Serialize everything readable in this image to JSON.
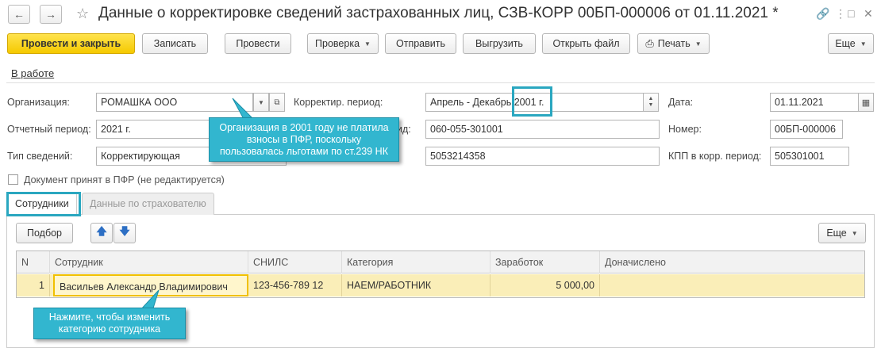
{
  "window": {
    "title": "Данные о корректировке сведений застрахованных лиц, СЗВ-КОРР 00БП-000006 от 01.11.2021 *"
  },
  "toolbar": {
    "post_close": "Провести и закрыть",
    "write": "Записать",
    "post": "Провести",
    "check": "Проверка",
    "send": "Отправить",
    "unload": "Выгрузить",
    "open_file": "Открыть файл",
    "print": "Печать",
    "more": "Еще"
  },
  "status_link": "В работе",
  "form": {
    "org_label": "Организация:",
    "org_value": "РОМАШКА ООО",
    "corr_period_label": "Корректир. период:",
    "corr_period_value": "Апрель - Декабрь 2001 г.",
    "date_label": "Дата:",
    "date_value": "01.11.2021",
    "report_period_label": "Отчетный период:",
    "report_period_value": "2021 г.",
    "reg_suffix_label": "ид:",
    "reg_value": "060-055-301001",
    "number_label": "Номер:",
    "number_value": "00БП-000006",
    "info_type_label": "Тип сведений:",
    "info_type_value": "Корректирующая",
    "inn_value": "5053214358",
    "kpp_label": "КПП в корр. период:",
    "kpp_value": "505301001",
    "accepted_label": "Документ принят в ПФР (не редактируется)"
  },
  "tabs": [
    {
      "label": "Сотрудники"
    },
    {
      "label": "Данные по страхователю"
    }
  ],
  "table_toolbar": {
    "select": "Подбор",
    "more": "Еще"
  },
  "table": {
    "columns": [
      "N",
      "Сотрудник",
      "СНИЛС",
      "Категория",
      "Заработок",
      "Доначислено"
    ],
    "rows": [
      {
        "n": "1",
        "employee": "Васильев Александр Владимирович",
        "snils": "123-456-789 12",
        "category": "НАЕМ/РАБОТНИК",
        "earnings": "5 000,00",
        "extra": ""
      }
    ]
  },
  "callouts": {
    "org": "Организация в 2001 году не платила взносы в ПФР, поскольку пользовалась льготами по ст.239 НК",
    "employee": "Нажмите, чтобы изменить категорию сотрудника"
  },
  "icons": {
    "back": "arrow-left-icon",
    "forward": "arrow-right-icon",
    "favorite": "star-icon",
    "link": "link-icon",
    "menu": "more-vert-icon",
    "maximize": "maximize-icon",
    "close": "close-icon",
    "printer": "printer-icon",
    "calendar": "calendar-icon",
    "move_up": "arrow-up-icon",
    "move_down": "arrow-down-icon"
  },
  "colors": {
    "primary_button": "#f5c900",
    "highlight": "#2aa7c0",
    "callout": "#32b6cf",
    "selected_row": "#faeeb8"
  }
}
